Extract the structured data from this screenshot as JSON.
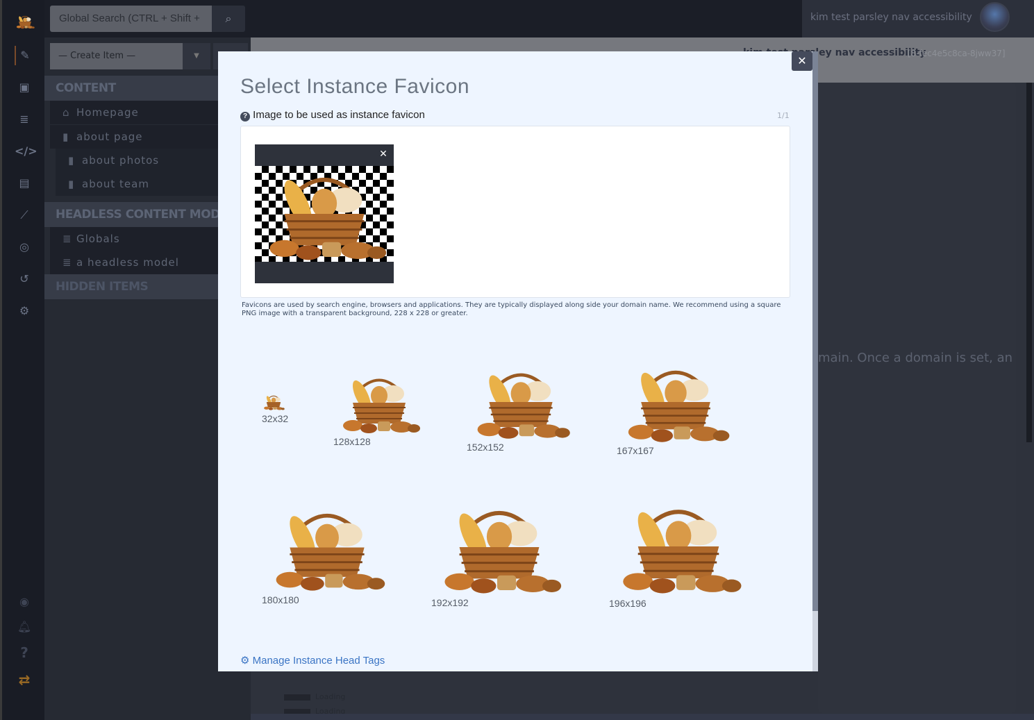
{
  "topbar": {
    "search_placeholder": "Global Search (CTRL + Shift +",
    "user_instance": "kim test parsley nav accessibility"
  },
  "sidebar": {
    "create_item": "— Create Item —",
    "sections": [
      {
        "title": "CONTENT",
        "items": [
          {
            "label": "Homepage",
            "icon": "home-icon"
          },
          {
            "label": "about page",
            "icon": "file-icon"
          },
          {
            "label": "about photos",
            "icon": "file-icon"
          },
          {
            "label": "about team",
            "icon": "file-icon"
          }
        ]
      },
      {
        "title": "HEADLESS CONTENT MODELS",
        "items": [
          {
            "label": "Globals",
            "icon": "database-icon"
          },
          {
            "label": "a headless model",
            "icon": "database-icon"
          }
        ]
      },
      {
        "title": "HIDDEN ITEMS",
        "items": []
      }
    ]
  },
  "background": {
    "instance_title": "kim test parsley nav accessibility",
    "instance_id": "[8-fec4e5c8ca-8jww37]",
    "domain_text": "main. Once a domain is set, an",
    "loading": [
      "Loading",
      "Loading"
    ]
  },
  "modal": {
    "title": "Select Instance Favicon",
    "field_label": "Image to be used as instance favicon",
    "count": "1/1",
    "help": "Favicons are used by search engine, browsers and applications. They are typically displayed along side your domain name. We recommend using a square PNG image with a transparent background, 228 x 228 or greater.",
    "sizes": [
      "32x32",
      "128x128",
      "152x152",
      "167x167",
      "180x180",
      "192x192",
      "196x196"
    ],
    "manage_link": "Manage Instance Head Tags"
  },
  "colors": {
    "accent": "#c2692a",
    "link": "#3a74c4",
    "modal_bg": "#eef5ff"
  }
}
